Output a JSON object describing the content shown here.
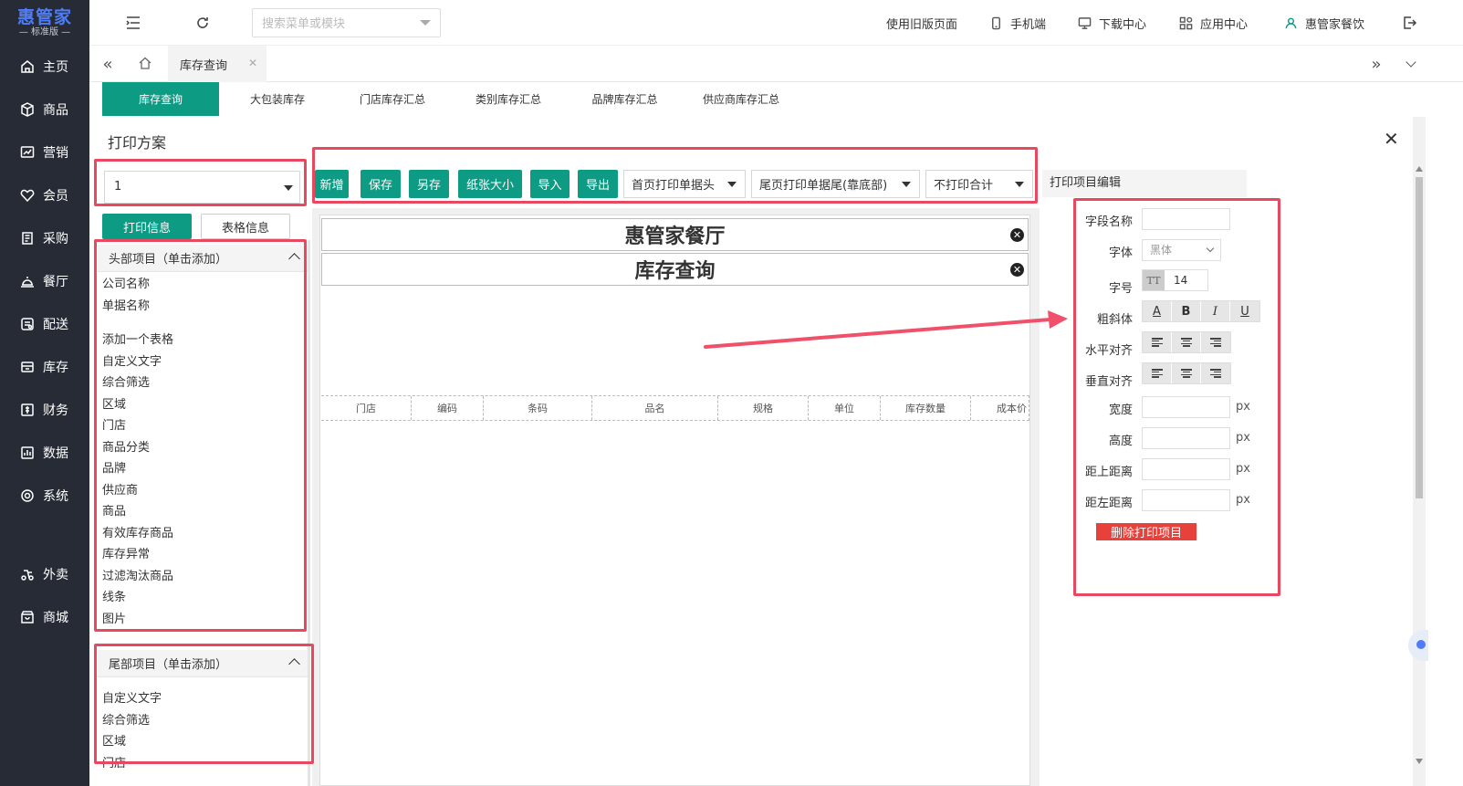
{
  "app": {
    "logo_main": "惠管家",
    "logo_sub": "— 标准版 —"
  },
  "sidebar": {
    "items": [
      {
        "label": "主页",
        "icon": "home-icon"
      },
      {
        "label": "商品",
        "icon": "box-icon"
      },
      {
        "label": "营销",
        "icon": "chart-icon"
      },
      {
        "label": "会员",
        "icon": "heart-icon"
      },
      {
        "label": "采购",
        "icon": "purchase-icon"
      },
      {
        "label": "餐厅",
        "icon": "restaurant-icon"
      },
      {
        "label": "配送",
        "icon": "delivery-icon"
      },
      {
        "label": "库存",
        "icon": "inventory-icon"
      },
      {
        "label": "财务",
        "icon": "finance-icon"
      },
      {
        "label": "数据",
        "icon": "data-icon"
      },
      {
        "label": "系统",
        "icon": "system-icon"
      },
      {
        "label": "外卖",
        "icon": "takeout-icon"
      },
      {
        "label": "商城",
        "icon": "mall-icon"
      }
    ]
  },
  "topbar": {
    "search_placeholder": "搜索菜单或模块",
    "links": {
      "old_page": "使用旧版页面",
      "mobile": "手机端",
      "download": "下载中心",
      "apps": "应用中心",
      "user": "惠管家餐饮"
    }
  },
  "tabs": {
    "open_tab": "库存查询"
  },
  "subtabs": [
    "库存查询",
    "大包装库存",
    "门店库存汇总",
    "类别库存汇总",
    "品牌库存汇总",
    "供应商库存汇总"
  ],
  "dialog": {
    "title": "打印方案",
    "scheme_value": "1",
    "print_info_btn": "打印信息",
    "table_info_btn": "表格信息"
  },
  "header_group": {
    "title": "头部项目（单击添加）",
    "items_a": [
      "公司名称",
      "单据名称"
    ],
    "items_b": [
      "添加一个表格",
      "自定义文字",
      "综合筛选",
      "区域",
      "门店",
      "商品分类",
      "品牌",
      "供应商",
      "商品",
      "有效库存商品",
      "库存异常",
      "过滤淘汰商品",
      "线条",
      "图片"
    ]
  },
  "footer_group": {
    "title": "尾部项目（单击添加）",
    "items": [
      "自定义文字",
      "综合筛选",
      "区域",
      "门店"
    ]
  },
  "toolbar": {
    "new": "新增",
    "save": "保存",
    "save_as": "另存",
    "paper_size": "纸张大小",
    "import": "导入",
    "export": "导出",
    "first_page_header": "首页打印单据头",
    "last_page_footer": "尾页打印单据尾(靠底部)",
    "total": "不打印合计"
  },
  "canvas": {
    "company_name": "惠管家餐厅",
    "doc_name": "库存查询",
    "columns": [
      "门店",
      "编码",
      "条码",
      "品名",
      "规格",
      "单位",
      "库存数量",
      "成本价"
    ]
  },
  "editor": {
    "title": "打印项目编辑",
    "field_name_label": "字段名称",
    "font_label": "字体",
    "font_value": "黑体",
    "size_label": "字号",
    "size_icon": "TT",
    "size_value": "14",
    "style_label": "粗斜体",
    "style_buttons": [
      "A",
      "B",
      "I",
      "U"
    ],
    "h_align_label": "水平对齐",
    "v_align_label": "垂直对齐",
    "width_label": "宽度",
    "height_label": "高度",
    "top_label": "距上距离",
    "left_label": "距左距离",
    "unit": "px",
    "delete_btn": "删除打印项目"
  },
  "colors": {
    "sidebar_bg": "#262b36",
    "accent": "#0d9b84",
    "logo": "#4f7df7",
    "highlight": "#e8495f",
    "danger": "#e8403a"
  }
}
